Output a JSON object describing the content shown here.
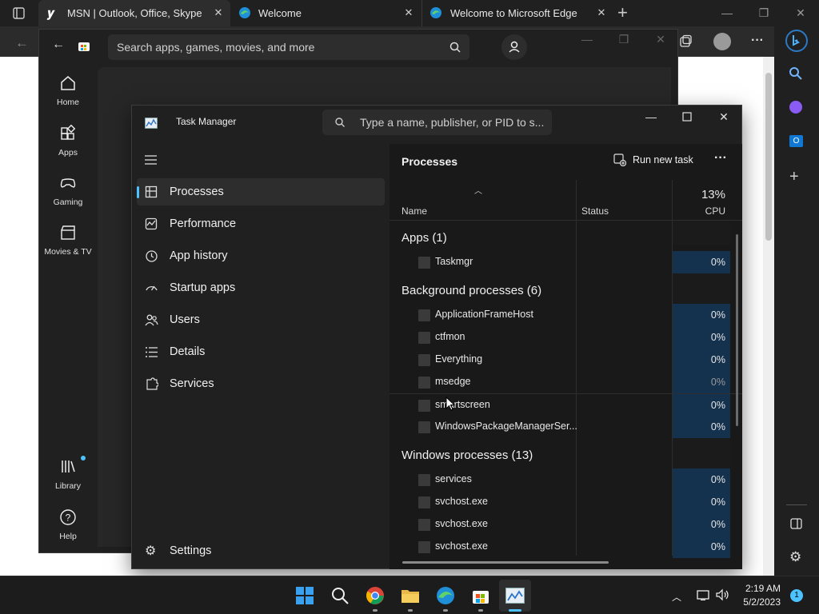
{
  "edge": {
    "tabs": [
      {
        "title": "MSN | Outlook, Office, Skype, Bi",
        "close": "✕"
      },
      {
        "title": "Welcome",
        "close": "✕"
      },
      {
        "title": "Welcome to Microsoft Edge",
        "close": "✕"
      }
    ],
    "new_tab": "+",
    "window_buttons": {
      "minimize": "—",
      "restore": "❐",
      "close": "✕"
    },
    "more": "···"
  },
  "store": {
    "search_placeholder": "Search apps, games, movies, and more",
    "nav": [
      {
        "label": "Home"
      },
      {
        "label": "Apps"
      },
      {
        "label": "Gaming"
      },
      {
        "label": "Movies & TV"
      },
      {
        "label": "Library"
      },
      {
        "label": "Help"
      }
    ]
  },
  "task_manager": {
    "title": "Task Manager",
    "search_placeholder": "Type a name, publisher, or PID to s...",
    "nav": [
      {
        "label": "Processes",
        "active": true
      },
      {
        "label": "Performance"
      },
      {
        "label": "App history"
      },
      {
        "label": "Startup apps"
      },
      {
        "label": "Users"
      },
      {
        "label": "Details"
      },
      {
        "label": "Services"
      }
    ],
    "settings_label": "Settings",
    "header": {
      "title": "Processes",
      "run_new_task": "Run new task",
      "more": "···"
    },
    "columns": {
      "name": "Name",
      "status": "Status",
      "cpu": "CPU",
      "cpu_total": "13%"
    },
    "groups": [
      {
        "label": "Apps (1)",
        "rows": [
          {
            "name": "Taskmgr",
            "cpu": "0%"
          }
        ]
      },
      {
        "label": "Background processes (6)",
        "rows": [
          {
            "name": "ApplicationFrameHost",
            "cpu": "0%"
          },
          {
            "name": "ctfmon",
            "cpu": "0%"
          },
          {
            "name": "Everything",
            "cpu": "0%"
          },
          {
            "name": "msedge",
            "cpu": "0%"
          },
          {
            "name": "smartscreen",
            "cpu": "0%"
          },
          {
            "name": "WindowsPackageManagerSer...",
            "cpu": "0%"
          }
        ]
      },
      {
        "label": "Windows processes (13)",
        "rows": [
          {
            "name": "services",
            "cpu": "0%"
          },
          {
            "name": "svchost.exe",
            "cpu": "0%"
          },
          {
            "name": "svchost.exe",
            "cpu": "0%"
          },
          {
            "name": "svchost.exe",
            "cpu": "0%"
          }
        ]
      }
    ]
  },
  "taskbar": {
    "time": "2:19 AM",
    "date": "5/2/2023",
    "notification_count": "1"
  },
  "colors": {
    "accent": "#4cc2ff",
    "cpu_cell": "#14314d"
  }
}
